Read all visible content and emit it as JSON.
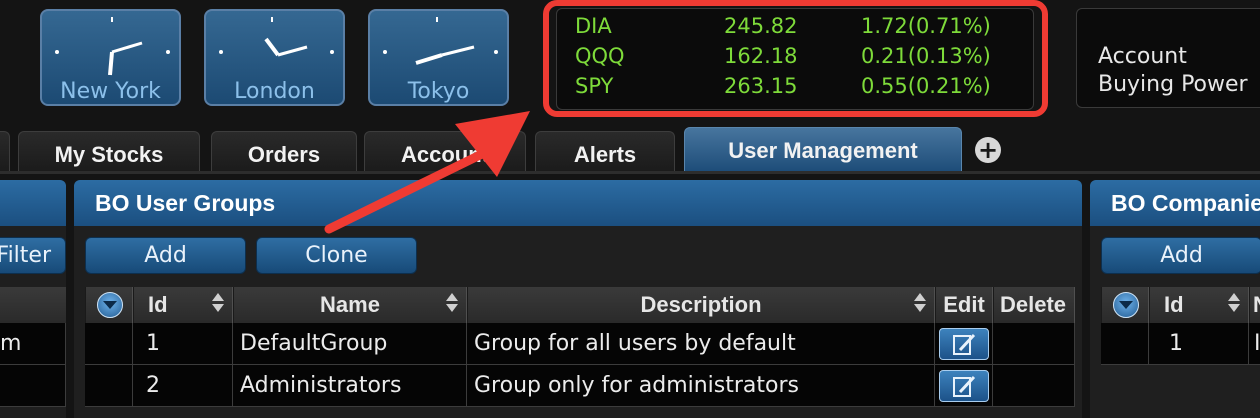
{
  "clocks": [
    {
      "city": "New York"
    },
    {
      "city": "London"
    },
    {
      "city": "Tokyo"
    }
  ],
  "ticker": [
    {
      "symbol": "DIA",
      "price": "245.82",
      "change": "1.72(0.71%)"
    },
    {
      "symbol": "QQQ",
      "price": "162.18",
      "change": "0.21(0.13%)"
    },
    {
      "symbol": "SPY",
      "price": "263.15",
      "change": "0.55(0.21%)"
    }
  ],
  "account": {
    "line1": "Account",
    "line2": "Buying Power"
  },
  "tabs": [
    {
      "label": "My Stocks"
    },
    {
      "label": "Orders"
    },
    {
      "label": "Account"
    },
    {
      "label": "Alerts"
    },
    {
      "label": "User Management",
      "active": true
    }
  ],
  "add_tab": "+",
  "left_panel": {
    "filter_label": "Filter",
    "row_fragment": "m"
  },
  "groups_panel": {
    "title": "BO User Groups",
    "add_label": "Add",
    "clone_label": "Clone",
    "columns": [
      "Id",
      "Name",
      "Description",
      "Edit",
      "Delete"
    ],
    "rows": [
      {
        "id": "1",
        "name": "DefaultGroup",
        "description": "Group for all users by default"
      },
      {
        "id": "2",
        "name": "Administrators",
        "description": "Group only for administrators"
      }
    ]
  },
  "companies_panel": {
    "title": "BO Companies",
    "add_label": "Add",
    "columns": [
      "Id",
      "N"
    ],
    "rows": [
      {
        "id": "1",
        "name": "I"
      }
    ]
  },
  "colors": {
    "ticker_text": "#7edb3a",
    "highlight": "#ef3b33",
    "panel_header": "#2c6ca3",
    "arrow": "#ef3b33"
  }
}
